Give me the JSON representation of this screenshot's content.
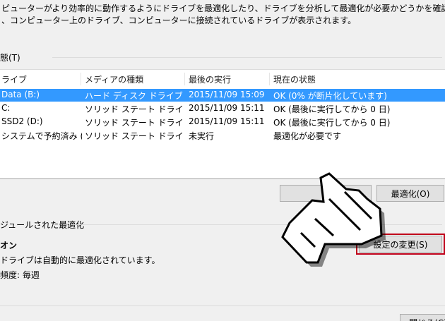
{
  "description": {
    "line1": "ピューターがより効率的に動作するようにドライブを最適化したり、ドライブを分析して最適化が必要かどうかを確認したりできます。ここ",
    "line2": "、コンピューター上のドライブ、コンピューターに接続されているドライブが表示されます。"
  },
  "status_section": {
    "label": "態(T)"
  },
  "drive_table": {
    "headers": [
      "ライブ",
      "メディアの種類",
      "最後の実行",
      "現在の状態"
    ],
    "rows": [
      {
        "drive": "Data (B:)",
        "media": "ハード ディスク ドライブ",
        "last_run": "2015/11/09 15:09",
        "status": "OK (0% が断片化しています)",
        "selected": true
      },
      {
        "drive": "C:",
        "media": "ソリッド ステート ドライブ",
        "last_run": "2015/11/09 15:11",
        "status": "OK (最後に実行してから 0 日)",
        "selected": false
      },
      {
        "drive": "SSD2 (D:)",
        "media": "ソリッド ステート ドライブ",
        "last_run": "2015/11/09 15:11",
        "status": "OK (最後に実行してから 0 日)",
        "selected": false
      },
      {
        "drive": "システムで予約済み (...",
        "media": "ソリッド ステート ドライブ",
        "last_run": "未実行",
        "status": "最適化が必要です",
        "selected": false
      }
    ]
  },
  "buttons": {
    "analyze": "",
    "optimize": "最適化(O)",
    "change_settings": "設定の変更(S)",
    "close": "閉じる(C)"
  },
  "scheduled": {
    "label": "ジュールされた最適化",
    "state": "オン",
    "info": "ドライブは自動的に最適化されています。",
    "frequency": "頻度: 毎週"
  },
  "colors": {
    "selection": "#3399ff",
    "highlight_border": "#c0001a"
  },
  "overlay_icon": "pointing-hand-cursor-icon"
}
